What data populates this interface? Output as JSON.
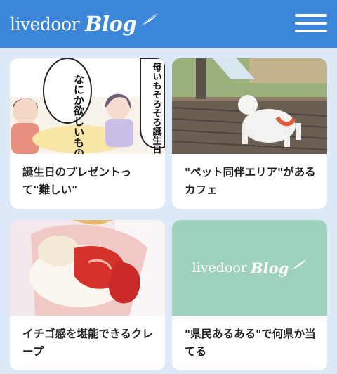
{
  "header": {
    "logo_word": "livedoor",
    "logo_blog": "Blog",
    "menu_icon": "hamburger-menu-icon",
    "background": "#3b86d9"
  },
  "page": {
    "background": "#dde9f7"
  },
  "thumb_logo": {
    "word": "livedoor",
    "blog": "Blog",
    "background": "#9fd2bd"
  },
  "cards": [
    {
      "title": "誕生日のプレゼントって\"難しい\"",
      "image": "manga-illustration",
      "manga_texts": [
        "なにか欲しいものあるー？",
        "母いもそろそろ誕生日でしょー"
      ]
    },
    {
      "title": "\"ペット同伴エリア\"があるカフェ",
      "image": "white-dog-on-wooden-deck"
    },
    {
      "title": "イチゴ感を堪能できるクレープ",
      "image": "strawberry-crepe"
    },
    {
      "title": "\"県民あるある\"で何県か当てる",
      "image": "livedoor-blog-logo"
    }
  ]
}
